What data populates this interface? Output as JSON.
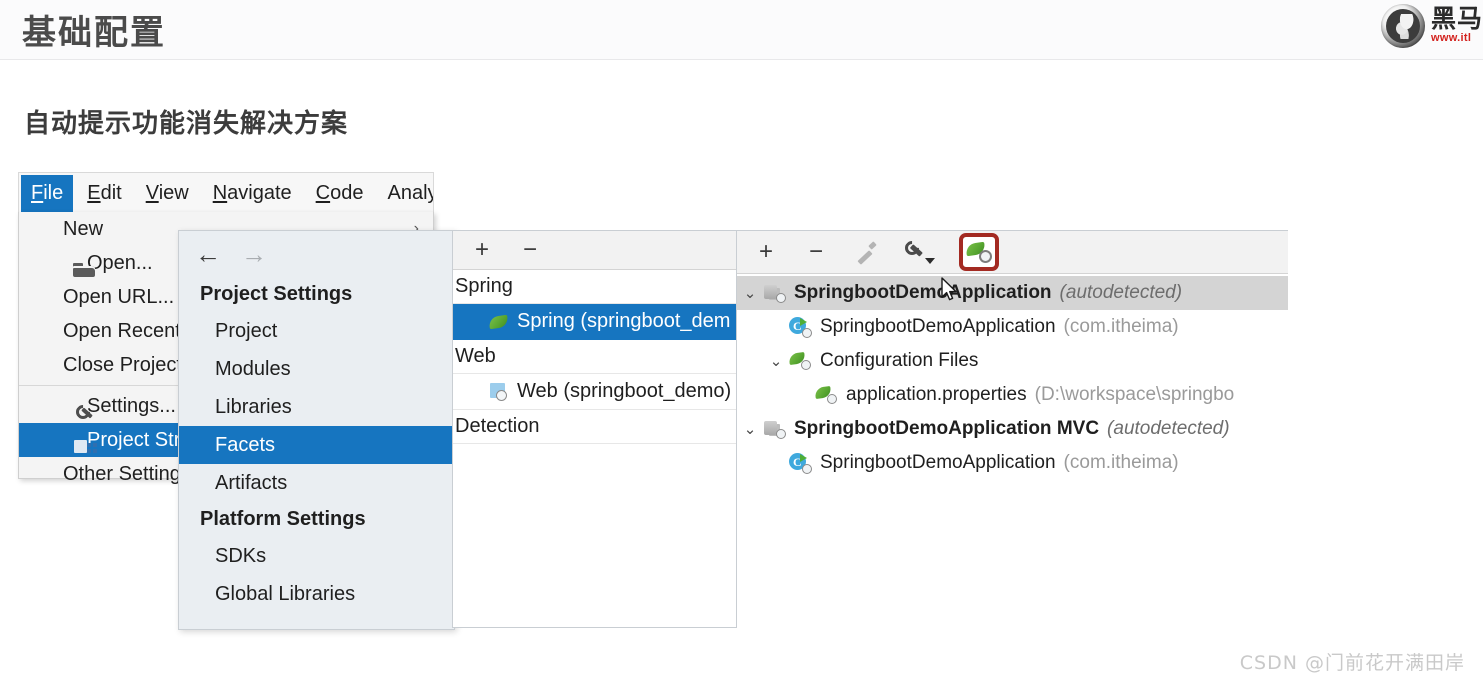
{
  "slide": {
    "title": "基础配置",
    "subtitle": "自动提示功能消失解决方案",
    "watermark": "CSDN @门前花开满田岸"
  },
  "brand": {
    "name": "黑马",
    "url": "www.itl",
    "logo_icon": "horse-head-logo"
  },
  "menubar": {
    "items": [
      {
        "label": "File",
        "mnemonic": "F",
        "active": true
      },
      {
        "label": "Edit",
        "mnemonic": "E",
        "active": false
      },
      {
        "label": "View",
        "mnemonic": "V",
        "active": false
      },
      {
        "label": "Navigate",
        "mnemonic": "N",
        "active": false
      },
      {
        "label": "Code",
        "mnemonic": "C",
        "active": false
      },
      {
        "label": "Analyze",
        "mnemonic": "z",
        "active": false
      }
    ]
  },
  "file_menu": {
    "items": [
      {
        "label": "New",
        "icon": "none",
        "submenu": true,
        "selected": false
      },
      {
        "label": "Open...",
        "icon": "folder-icon",
        "submenu": false,
        "selected": false
      },
      {
        "label": "Open URL...",
        "icon": "none",
        "submenu": false,
        "selected": false
      },
      {
        "label": "Open Recent",
        "icon": "none",
        "submenu": false,
        "selected": false
      },
      {
        "label": "Close Project",
        "icon": "none",
        "submenu": false,
        "selected": false
      },
      {
        "label": "Settings...",
        "icon": "wrench-icon",
        "submenu": false,
        "selected": false
      },
      {
        "label": "Project Struct",
        "icon": "project-structure-icon",
        "submenu": false,
        "selected": true
      },
      {
        "label": "Other Setting",
        "icon": "none",
        "submenu": false,
        "selected": false
      }
    ],
    "submenu_arrow": "›"
  },
  "settings_panel": {
    "nav": {
      "back": "←",
      "forward": "→"
    },
    "sections": [
      {
        "title": "Project Settings",
        "items": [
          {
            "label": "Project",
            "selected": false
          },
          {
            "label": "Modules",
            "selected": false
          },
          {
            "label": "Libraries",
            "selected": false
          },
          {
            "label": "Facets",
            "selected": true
          },
          {
            "label": "Artifacts",
            "selected": false
          }
        ]
      },
      {
        "title": "Platform Settings",
        "items": [
          {
            "label": "SDKs",
            "selected": false
          },
          {
            "label": "Global Libraries",
            "selected": false
          }
        ]
      }
    ]
  },
  "facets_column": {
    "toolbar": [
      {
        "label": "+",
        "name": "add-facet-button"
      },
      {
        "label": "−",
        "name": "remove-facet-button"
      }
    ],
    "rows": [
      {
        "kind": "group",
        "label": "Spring",
        "icon": "none",
        "selected": false
      },
      {
        "kind": "leaf",
        "label": "Spring (springboot_dem",
        "icon": "spring-leaf-icon",
        "selected": true
      },
      {
        "kind": "group",
        "label": "Web",
        "icon": "none",
        "selected": false
      },
      {
        "kind": "leaf",
        "label": "Web (springboot_demo)",
        "icon": "web-icon",
        "selected": false
      },
      {
        "kind": "group",
        "label": "Detection",
        "icon": "none",
        "selected": false
      }
    ]
  },
  "detail_panel": {
    "toolbar": [
      {
        "label": "+",
        "name": "add-context-button",
        "icon": "plus-icon",
        "highlighted": false
      },
      {
        "label": "−",
        "name": "remove-context-button",
        "icon": "minus-icon",
        "highlighted": false
      },
      {
        "label": "",
        "name": "edit-button",
        "icon": "pencil-icon",
        "highlighted": false
      },
      {
        "label": "",
        "name": "configure-button",
        "icon": "wrench-dropdown-icon",
        "highlighted": false
      },
      {
        "label": "",
        "name": "spring-config-button",
        "icon": "leaf-gear-icon",
        "highlighted": true
      }
    ],
    "highlight_color": "#a32a22",
    "tree": [
      {
        "indent": 0,
        "twisty": "expanded",
        "icon": "module-icon",
        "label": "SpringbootDemoApplication",
        "bold": true,
        "suffix": "(autodetected)",
        "suffix_italic": true,
        "selected": true
      },
      {
        "indent": 1,
        "twisty": "none",
        "icon": "class-run-icon",
        "label": "SpringbootDemoApplication",
        "bold": false,
        "suffix": "(com.itheima)",
        "suffix_italic": false,
        "selected": false
      },
      {
        "indent": 1,
        "twisty": "expanded",
        "icon": "leaf-gear-icon",
        "label": "Configuration Files",
        "bold": false,
        "suffix": "",
        "suffix_italic": false,
        "selected": false
      },
      {
        "indent": 2,
        "twisty": "none",
        "icon": "leaf-gear-icon",
        "label": "application.properties",
        "bold": false,
        "suffix": "(D:\\workspace\\springbo",
        "suffix_italic": false,
        "selected": false
      },
      {
        "indent": 0,
        "twisty": "expanded",
        "icon": "module-icon",
        "label": "SpringbootDemoApplication MVC",
        "bold": true,
        "suffix": "(autodetected)",
        "suffix_italic": true,
        "selected": false
      },
      {
        "indent": 1,
        "twisty": "none",
        "icon": "class-run-icon",
        "label": "SpringbootDemoApplication",
        "bold": false,
        "suffix": "(com.itheima)",
        "suffix_italic": false,
        "selected": false
      }
    ]
  },
  "cursor": {
    "icon": "mouse-pointer-icon"
  }
}
